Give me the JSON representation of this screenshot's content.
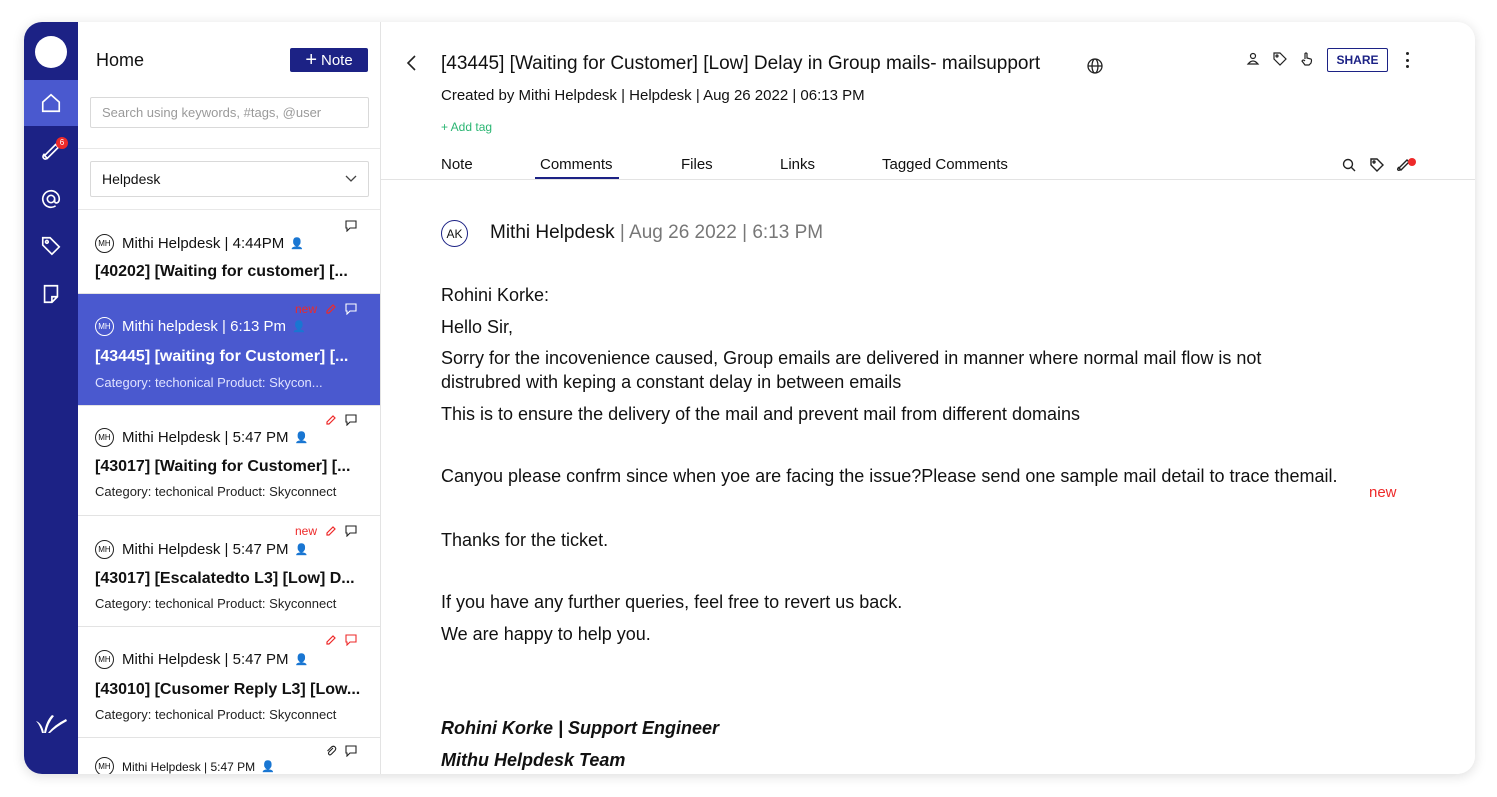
{
  "colors": {
    "navy": "#1c2285",
    "selected": "#4a59cf",
    "accent_red": "#ee2a2a",
    "tag_green": "#2bb673"
  },
  "rail": {
    "items": [
      {
        "icon": "home-icon",
        "active": true
      },
      {
        "icon": "bell-icon",
        "badge": "6"
      },
      {
        "icon": "at-icon"
      },
      {
        "icon": "tag-icon"
      },
      {
        "icon": "note-icon"
      }
    ],
    "logo": "mithi-logo"
  },
  "list": {
    "title": "Home",
    "note_button": "Note",
    "search_placeholder": "Search using keywords, #tags, @user",
    "department": "Helpdesk",
    "items": [
      {
        "avatar": "MH",
        "meta": "Mithi Helpdesk | 4:44PM",
        "title": "[40202] [Waiting for customer] [...",
        "category": "",
        "new": ""
      },
      {
        "avatar": "MH",
        "meta": "Mithi helpdesk | 6:13 Pm",
        "title": "[43445] [waiting for Customer] [...",
        "category": "Category: techonical Product: Skycon...",
        "new": "new"
      },
      {
        "avatar": "MH",
        "meta": "Mithi Helpdesk | 5:47 PM",
        "title": "[43017] [Waiting for Customer] [...",
        "category": "Category: techonical Product: Skyconnect",
        "new": ""
      },
      {
        "avatar": "MH",
        "meta": "Mithi Helpdesk | 5:47 PM",
        "title": "[43017] [Escalatedto L3] [Low] D...",
        "category": "Category: techonical Product: Skyconnect",
        "new": "new"
      },
      {
        "avatar": "MH",
        "meta": "Mithi Helpdesk | 5:47 PM",
        "title": "[43010] [Cusomer Reply L3] [Low...",
        "category": "Category: techonical Product: Skyconnect",
        "new": ""
      },
      {
        "avatar": "MH",
        "meta": "Mithi Helpdesk | 5:47 PM",
        "title": "",
        "category": "",
        "new": ""
      }
    ]
  },
  "main": {
    "subject": "[43445] [Waiting for Customer] [Low] Delay in Group mails- mailsupport",
    "created": "Created by Mithi Helpdesk | Helpdesk | Aug 26 2022 | 06:13 PM",
    "add_tag": "+ Add tag",
    "share": "SHARE",
    "tabs": [
      "Note",
      "Comments",
      "Files",
      "Links",
      "Tagged Comments"
    ],
    "active_tab": "Comments",
    "comment": {
      "avatar": "AK",
      "author": "Mithi Helpdesk",
      "date": " | Aug 26 2022 | 6:13 PM",
      "lines": [
        "Rohini Korke:",
        "Hello Sir,",
        "Sorry for the incovenience caused, Group emails are delivered in manner where normal mail flow is not",
        "distrubred with keping a constant delay in between emails",
        "This is to ensure the delivery of the mail and prevent mail from different domains",
        "Canyou please confrm since when yoe are facing the issue?Please send one sample mail detail to trace themail.",
        "Thanks for the ticket.",
        "If you have any further queries, feel free to revert us back.",
        "We are happy to help you."
      ],
      "new_label": "new",
      "signature": [
        "Rohini Korke | Support Engineer",
        "Mithu Helpdesk Team"
      ]
    }
  }
}
